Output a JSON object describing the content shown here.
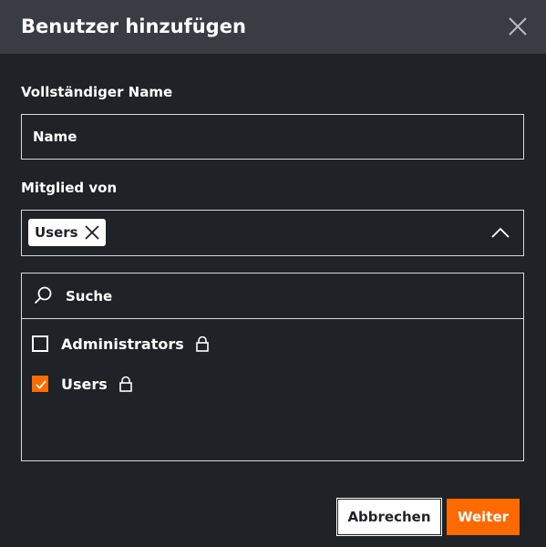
{
  "dialog": {
    "title": "Benutzer hinzufügen"
  },
  "form": {
    "full_name_label": "Vollständiger Name",
    "full_name_placeholder": "Name",
    "member_of_label": "Mitglied von",
    "selected_chip": "Users"
  },
  "list": {
    "search_placeholder": "Suche",
    "items": [
      {
        "label": "Administrators",
        "checked": false,
        "locked": true
      },
      {
        "label": "Users",
        "checked": true,
        "locked": true
      }
    ]
  },
  "buttons": {
    "cancel": "Abbrechen",
    "next": "Weiter"
  },
  "colors": {
    "accent": "#ff6a00",
    "header_bg": "#393d43",
    "body_bg": "#1f2226"
  },
  "icons": {
    "close": "close-icon",
    "chip_remove": "x-icon",
    "chevron": "chevron-up-icon",
    "search": "search-icon",
    "lock": "lock-icon",
    "check": "checkmark-icon"
  }
}
